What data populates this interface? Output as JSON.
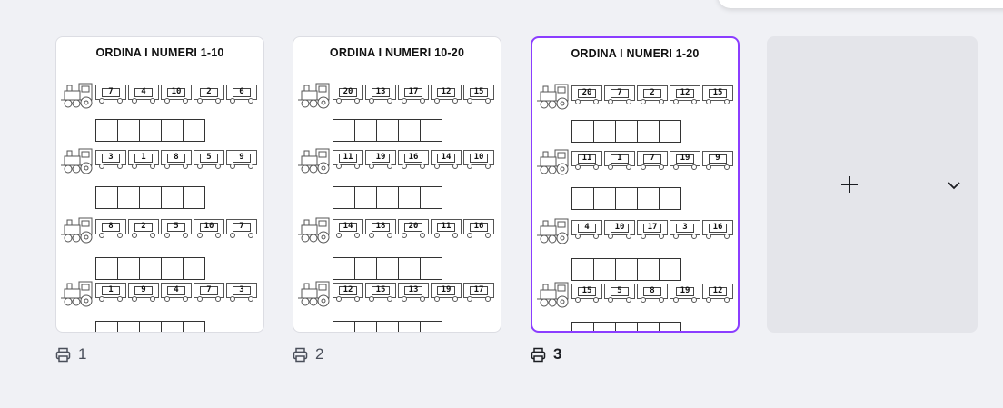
{
  "pages": [
    {
      "number": "1",
      "title": "ORDINA I NUMERI 1-10",
      "rows": [
        [
          "7",
          "4",
          "10",
          "2",
          "6"
        ],
        [
          "3",
          "1",
          "8",
          "5",
          "9"
        ],
        [
          "8",
          "2",
          "5",
          "10",
          "7"
        ],
        [
          "1",
          "9",
          "4",
          "7",
          "3"
        ]
      ]
    },
    {
      "number": "2",
      "title": "ORDINA I NUMERI 10-20",
      "rows": [
        [
          "20",
          "13",
          "17",
          "12",
          "15"
        ],
        [
          "11",
          "19",
          "16",
          "14",
          "10"
        ],
        [
          "14",
          "18",
          "20",
          "11",
          "16"
        ],
        [
          "12",
          "15",
          "13",
          "19",
          "17"
        ]
      ]
    },
    {
      "number": "3",
      "title": "ORDINA I NUMERI 1-20",
      "rows": [
        [
          "20",
          "7",
          "2",
          "12",
          "15"
        ],
        [
          "11",
          "1",
          "7",
          "19",
          "9"
        ],
        [
          "4",
          "10",
          "17",
          "3",
          "16"
        ],
        [
          "15",
          "5",
          "8",
          "19",
          "12"
        ]
      ]
    }
  ],
  "selected_page": "3",
  "icons": {
    "page_number": "printer-icon",
    "add": "plus-icon",
    "expand": "chevron-down-icon"
  },
  "colors": {
    "background": "#f0f1f5",
    "selection": "#8b3dff",
    "add_page_bg": "#e4e5ea"
  }
}
